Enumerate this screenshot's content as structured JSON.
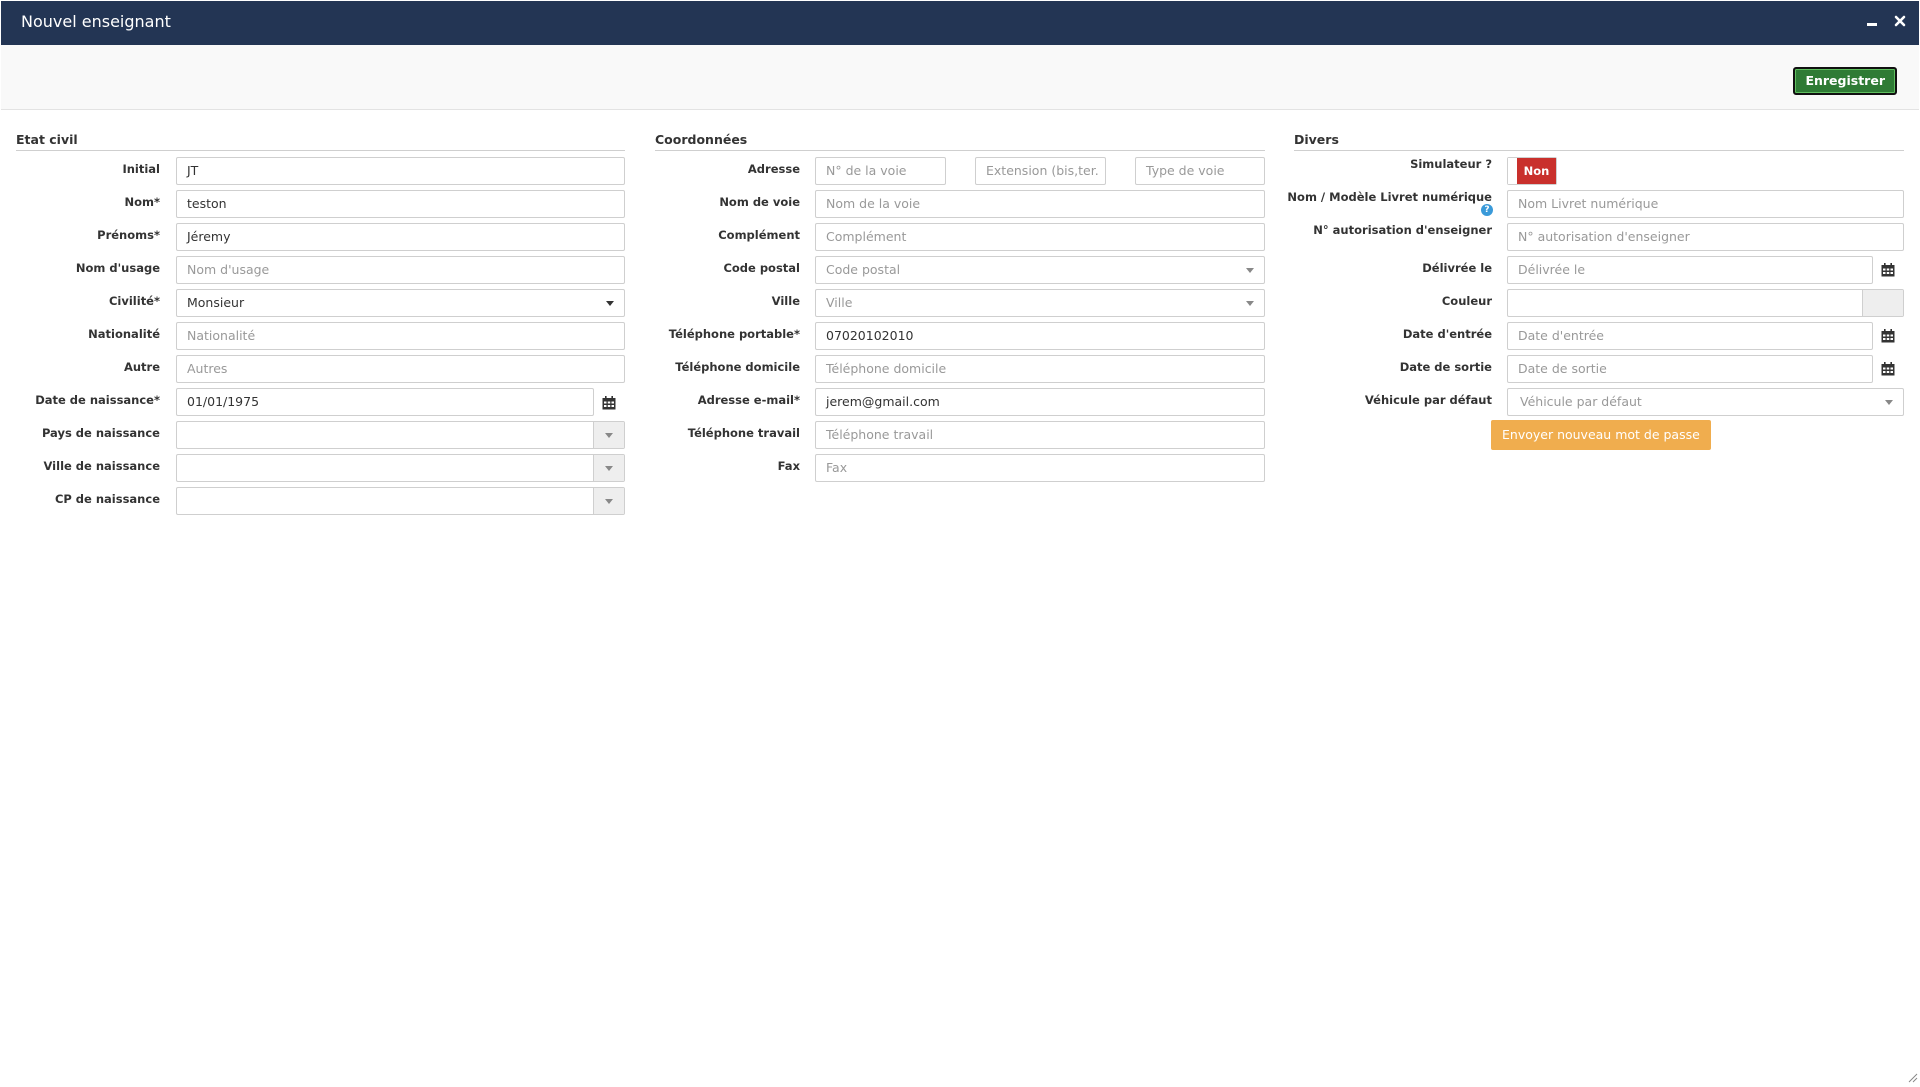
{
  "window": {
    "title": "Nouvel enseignant",
    "minimize_icon": "minimize-icon",
    "close_icon": "close-icon"
  },
  "toolbar": {
    "save_label": "Enregistrer",
    "save_color": "#2f7b35"
  },
  "etat_civil": {
    "title": "Etat civil",
    "initial": {
      "label": "Initial",
      "value": "JT"
    },
    "nom": {
      "label": "Nom*",
      "value": "teston"
    },
    "prenoms": {
      "label": "Prénoms*",
      "value": "Jéremy"
    },
    "nom_usage": {
      "label": "Nom d'usage",
      "placeholder": "Nom d'usage"
    },
    "civilite": {
      "label": "Civilité*",
      "value": "Monsieur"
    },
    "nationalite": {
      "label": "Nationalité",
      "placeholder": "Nationalité"
    },
    "autre": {
      "label": "Autre",
      "placeholder": "Autres"
    },
    "date_naissance": {
      "label": "Date de naissance*",
      "value": "01/01/1975"
    },
    "pays_naissance": {
      "label": "Pays de naissance",
      "value": ""
    },
    "ville_naissance": {
      "label": "Ville de naissance",
      "value": ""
    },
    "cp_naissance": {
      "label": "CP de naissance",
      "value": ""
    }
  },
  "coordonnees": {
    "title": "Coordonnées",
    "adresse": {
      "label": "Adresse",
      "num_placeholder": "N° de la voie",
      "ext_placeholder": "Extension (bis,ter.",
      "type_placeholder": "Type de voie"
    },
    "nom_voie": {
      "label": "Nom de voie",
      "placeholder": "Nom de la voie"
    },
    "complement": {
      "label": "Complément",
      "placeholder": "Complément"
    },
    "code_postal": {
      "label": "Code postal",
      "placeholder": "Code postal"
    },
    "ville": {
      "label": "Ville",
      "placeholder": "Ville"
    },
    "tel_portable": {
      "label": "Téléphone portable*",
      "value": "07020102010"
    },
    "tel_domicile": {
      "label": "Téléphone domicile",
      "placeholder": "Téléphone domicile"
    },
    "email": {
      "label": "Adresse e-mail*",
      "value": "jerem@gmail.com"
    },
    "tel_travail": {
      "label": "Téléphone travail",
      "placeholder": "Téléphone travail"
    },
    "fax": {
      "label": "Fax",
      "placeholder": "Fax"
    }
  },
  "divers": {
    "title": "Divers",
    "simulateur": {
      "label": "Simulateur ?",
      "value": "Non",
      "color": "#c9302c"
    },
    "livret": {
      "label": "Nom / Modèle Livret numérique",
      "placeholder": "Nom Livret numérique",
      "help_icon": "help-icon"
    },
    "autorisation": {
      "label": "N° autorisation d'enseigner",
      "placeholder": "N° autorisation d'enseigner"
    },
    "delivree": {
      "label": "Délivrée le",
      "placeholder": "Délivrée le"
    },
    "couleur": {
      "label": "Couleur",
      "value": ""
    },
    "date_entree": {
      "label": "Date d'entrée",
      "placeholder": "Date d'entrée"
    },
    "date_sortie": {
      "label": "Date de sortie",
      "placeholder": "Date de sortie"
    },
    "vehicule": {
      "label": "Véhicule par défaut",
      "placeholder": "Véhicule par défaut"
    },
    "reset_password_label": "Envoyer nouveau mot de passe",
    "reset_password_color": "#f0ad4e"
  },
  "icons": {
    "calendar": "calendar-icon",
    "resize": "resize-grip-icon"
  }
}
